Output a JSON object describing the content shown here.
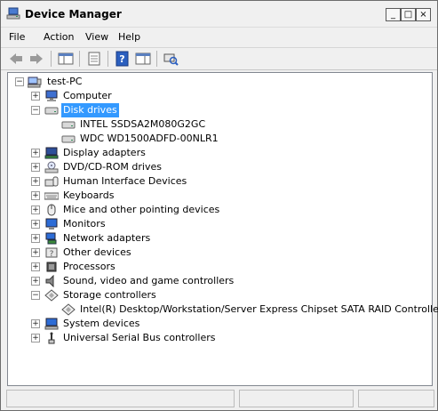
{
  "window": {
    "title": "Device Manager"
  },
  "menu": {
    "file": "File",
    "action": "Action",
    "view": "View",
    "help": "Help"
  },
  "toolbar": {
    "buttons": [
      "back-icon",
      "forward-icon",
      "show-hide-console-tree-icon",
      "properties-icon",
      "help-icon",
      "show-action-pane-icon",
      "scan-hardware-icon"
    ]
  },
  "tree": {
    "root": "test-PC",
    "items": [
      {
        "label": "Computer",
        "icon": "computer-icon",
        "state": "collapsed"
      },
      {
        "label": "Disk drives",
        "icon": "disk-drive-icon",
        "state": "expanded",
        "selected": true,
        "children": [
          "INTEL SSDSA2M080G2GC",
          "WDC WD1500ADFD-00NLR1"
        ]
      },
      {
        "label": "Display adapters",
        "icon": "display-adapter-icon",
        "state": "collapsed"
      },
      {
        "label": "DVD/CD-ROM drives",
        "icon": "dvd-drive-icon",
        "state": "collapsed"
      },
      {
        "label": "Human Interface Devices",
        "icon": "hid-icon",
        "state": "collapsed"
      },
      {
        "label": "Keyboards",
        "icon": "keyboard-icon",
        "state": "collapsed"
      },
      {
        "label": "Mice and other pointing devices",
        "icon": "mouse-icon",
        "state": "collapsed"
      },
      {
        "label": "Monitors",
        "icon": "monitor-icon",
        "state": "collapsed"
      },
      {
        "label": "Network adapters",
        "icon": "network-adapter-icon",
        "state": "collapsed"
      },
      {
        "label": "Other devices",
        "icon": "other-devices-icon",
        "state": "collapsed"
      },
      {
        "label": "Processors",
        "icon": "processor-icon",
        "state": "collapsed"
      },
      {
        "label": "Sound, video and game controllers",
        "icon": "sound-icon",
        "state": "collapsed"
      },
      {
        "label": "Storage controllers",
        "icon": "storage-controller-icon",
        "state": "expanded",
        "children": [
          "Intel(R) Desktop/Workstation/Server Express Chipset SATA RAID Controller"
        ]
      },
      {
        "label": "System devices",
        "icon": "system-devices-icon",
        "state": "collapsed"
      },
      {
        "label": "Universal Serial Bus controllers",
        "icon": "usb-icon",
        "state": "collapsed"
      }
    ]
  },
  "colors": {
    "selection": "#3399ff",
    "window_bg": "#f0f0f0",
    "tree_bg": "#ffffff"
  }
}
